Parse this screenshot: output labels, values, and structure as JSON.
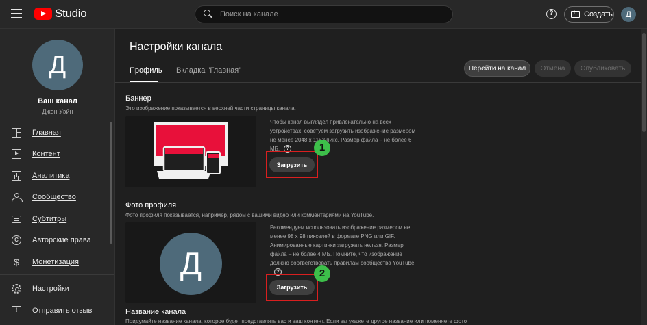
{
  "topbar": {
    "logo_text": "Studio",
    "search_placeholder": "Поиск на канале",
    "help_glyph": "?",
    "create_label": "Создать",
    "avatar_letter": "Д"
  },
  "sidebar": {
    "avatar_letter": "Д",
    "channel_label": "Ваш канал",
    "user_name": "Джон Уэйн",
    "items": [
      {
        "label": "Главная",
        "icon": "dashboard-icon"
      },
      {
        "label": "Контент",
        "icon": "content-icon"
      },
      {
        "label": "Аналитика",
        "icon": "analytics-icon"
      },
      {
        "label": "Сообщество",
        "icon": "community-icon"
      },
      {
        "label": "Субтитры",
        "icon": "subtitles-icon"
      },
      {
        "label": "Авторские права",
        "icon": "copyright-icon"
      },
      {
        "label": "Монетизация",
        "icon": "monetization-icon"
      }
    ],
    "bottom_items": [
      {
        "label": "Настройки",
        "icon": "settings-icon"
      },
      {
        "label": "Отправить отзыв",
        "icon": "feedback-icon"
      }
    ]
  },
  "main": {
    "title": "Настройки канала",
    "tabs": [
      {
        "label": "Профиль",
        "active": true
      },
      {
        "label": "Вкладка \"Главная\"",
        "active": false
      }
    ],
    "buttons": {
      "go_to_channel": "Перейти на канал",
      "cancel": "Отмена",
      "publish": "Опубликовать"
    },
    "banner": {
      "title": "Баннер",
      "description": "Это изображение показывается в верхней части страницы канала.",
      "hint": "Чтобы канал выглядел привлекательно на всех устройствах, советуем загрузить изображение размером не менее 2048 x 1152 пикс. Размер файла – не более 6 МБ.",
      "upload_label": "Загрузить",
      "badge": "1"
    },
    "photo": {
      "title": "Фото профиля",
      "description": "Фото профиля показывается, например, рядом с вашими видео или комментариями на YouTube.",
      "hint": "Рекомендуем использовать изображение размером не менее 98 x 98 пикселей в формате PNG или GIF. Анимированные картинки загружать нельзя. Размер файла – не более 4 МБ. Помните, что изображение должно соответствовать правилам сообщества YouTube.",
      "avatar_letter": "Д",
      "upload_label": "Загрузить",
      "badge": "2"
    },
    "name_section": {
      "title": "Название канала",
      "description": "Придумайте название канала, которое будет представлять вас и ваш контент. Если вы укажете другое название или поменяете фото"
    }
  },
  "colors": {
    "brand_red": "#ff0000",
    "highlight_red": "#d91f1f",
    "badge_green": "#3dbf4a",
    "avatar_bg": "#4e6a7a"
  }
}
